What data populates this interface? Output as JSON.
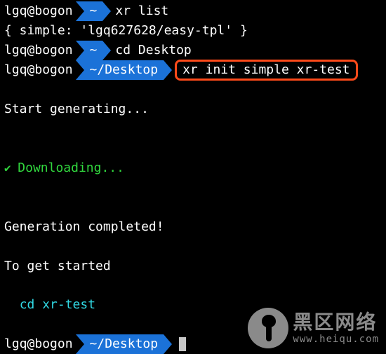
{
  "prompts": [
    {
      "user": "lgq",
      "host": "bogon",
      "path": "~",
      "command": "xr list"
    },
    {
      "user": "lgq",
      "host": "bogon",
      "path": "~",
      "command": "cd Desktop"
    },
    {
      "user": "lgq",
      "host": "bogon",
      "path": "~/Desktop",
      "command": "xr init simple xr-test",
      "highlighted": true
    },
    {
      "user": "lgq",
      "host": "bogon",
      "path": "~/Desktop",
      "command": ""
    }
  ],
  "list_output": "{ simple: 'lgq627628/easy-tpl' }",
  "messages": {
    "start": "Start generating...",
    "downloading": "Downloading...",
    "done": "Generation completed!",
    "hint_title": "To get started",
    "hint_cmd": "cd xr-test"
  },
  "watermark": {
    "brand": "黑区网络",
    "domain": "www.heiqu.com"
  },
  "colors": {
    "accent": "#1b72d8",
    "highlight_border": "#ff4a1a",
    "cyan": "#31d8e3"
  }
}
